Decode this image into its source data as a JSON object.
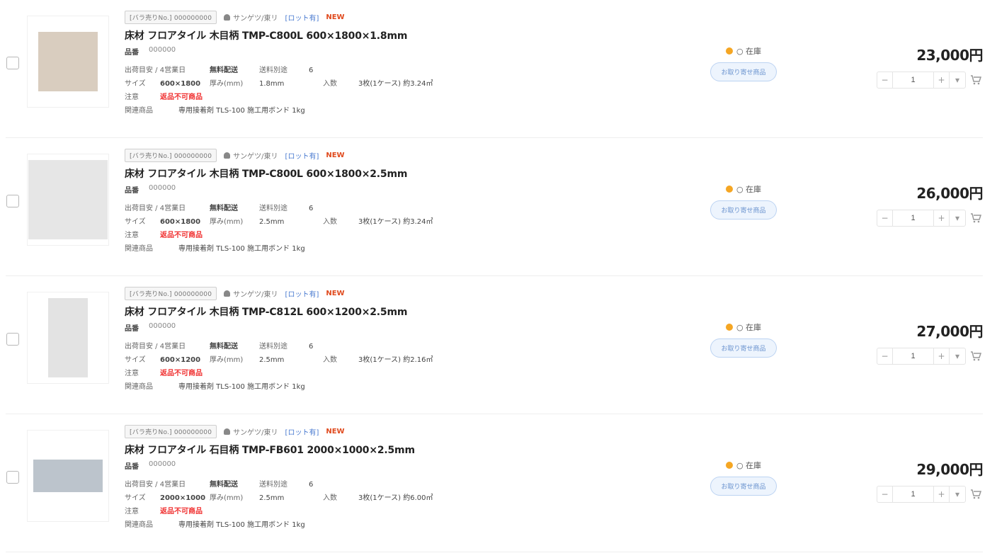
{
  "items": [
    {
      "badge": "[バラ売りNo.] 000000000",
      "maker": "サンゲツ/東リ",
      "tag_blue": "[ロット有]",
      "tag_red": "NEW",
      "title": "床材 フロアタイル 木目柄 TMP-C800L 600×1800×1.8mm",
      "code_label": "品番",
      "code_value": "000000",
      "spec1": [
        "出荷目安 / 4営業日",
        "無料配送",
        "送料別途",
        "6"
      ],
      "spec2": [
        "サイズ",
        "600×1800",
        "厚み(mm)",
        "1.8mm",
        "入数",
        "3枚(1ケース) 約3.24㎡"
      ],
      "spec3_label": "注意",
      "spec3_warning": "返品不可商品",
      "spec4_label": "関連商品",
      "spec4_value": "専用接着剤 TLS-100 施工用ボンド 1kg",
      "stock_label": "○ 在庫",
      "stock_pill": "お取り寄せ商品",
      "price": "23,000円",
      "qty": "1",
      "thumb_color": "#d9cdbf"
    },
    {
      "badge": "[バラ売りNo.] 000000000",
      "maker": "サンゲツ/東リ",
      "tag_blue": "[ロット有]",
      "tag_red": "NEW",
      "title": "床材 フロアタイル 木目柄 TMP-C800L 600×1800×2.5mm",
      "code_label": "品番",
      "code_value": "000000",
      "spec1": [
        "出荷目安 / 4営業日",
        "無料配送",
        "送料別途",
        "6"
      ],
      "spec2": [
        "サイズ",
        "600×1800",
        "厚み(mm)",
        "2.5mm",
        "入数",
        "3枚(1ケース) 約3.24㎡"
      ],
      "spec3_label": "注意",
      "spec3_warning": "返品不可商品",
      "spec4_label": "関連商品",
      "spec4_value": "専用接着剤 TLS-100 施工用ボンド 1kg",
      "stock_label": "○ 在庫",
      "stock_pill": "お取り寄せ商品",
      "price": "26,000円",
      "qty": "1",
      "thumb_color": "#e6e6e6"
    },
    {
      "badge": "[バラ売りNo.] 000000000",
      "maker": "サンゲツ/東リ",
      "tag_blue": "[ロット有]",
      "tag_red": "NEW",
      "title": "床材 フロアタイル 木目柄 TMP-C812L 600×1200×2.5mm",
      "code_label": "品番",
      "code_value": "000000",
      "spec1": [
        "出荷目安 / 4営業日",
        "無料配送",
        "送料別途",
        "6"
      ],
      "spec2": [
        "サイズ",
        "600×1200",
        "厚み(mm)",
        "2.5mm",
        "入数",
        "3枚(1ケース) 約2.16㎡"
      ],
      "spec3_label": "注意",
      "spec3_warning": "返品不可商品",
      "spec4_label": "関連商品",
      "spec4_value": "専用接着剤 TLS-100 施工用ボンド 1kg",
      "stock_label": "○ 在庫",
      "stock_pill": "お取り寄せ商品",
      "price": "27,000円",
      "qty": "1",
      "thumb_color": "#e3e3e3"
    },
    {
      "badge": "[バラ売りNo.] 000000000",
      "maker": "サンゲツ/東リ",
      "tag_blue": "[ロット有]",
      "tag_red": "NEW",
      "title": "床材 フロアタイル 石目柄 TMP-FB601 2000×1000×2.5mm",
      "code_label": "品番",
      "code_value": "000000",
      "spec1": [
        "出荷目安 / 4営業日",
        "無料配送",
        "送料別途",
        "6"
      ],
      "spec2": [
        "サイズ",
        "2000×1000",
        "厚み(mm)",
        "2.5mm",
        "入数",
        "3枚(1ケース) 約6.00㎡"
      ],
      "spec3_label": "注意",
      "spec3_warning": "返品不可商品",
      "spec4_label": "関連商品",
      "spec4_value": "専用接着剤 TLS-100 施工用ボンド 1kg",
      "stock_label": "○ 在庫",
      "stock_pill": "お取り寄せ商品",
      "price": "29,000円",
      "qty": "1",
      "thumb_color": "#bcc4cc"
    }
  ],
  "colors": {
    "accent_red": "#f03030",
    "link_blue": "#4a7bd0",
    "stock_dot": "#f5a623"
  }
}
